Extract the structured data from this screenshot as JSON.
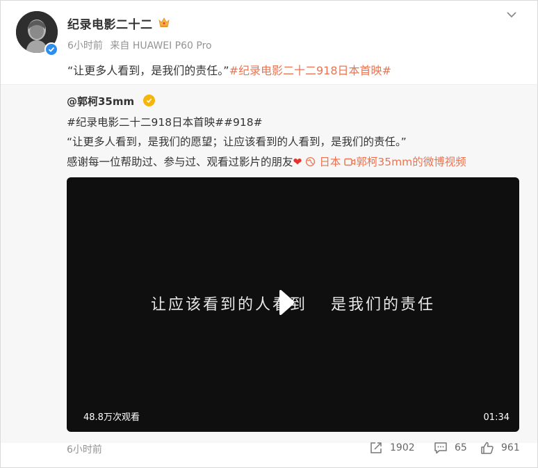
{
  "post": {
    "author": "纪录电影二十二",
    "time": "6小时前",
    "source": "来自 HUAWEI P60 Pro",
    "text": "“让更多人看到，是我们的责任。”",
    "hashtag": "#纪录电影二十二918日本首映#"
  },
  "repost": {
    "author": "@郭柯35mm",
    "hashtags": "#纪录电影二十二918日本首映##918#",
    "line1": "“让更多人看到，是我们的愿望；让应该看到的人看到，是我们的责任。”",
    "line2_text": "感谢每一位帮助过、参与过、观看过影片的朋友",
    "location_label": "日本",
    "video_link_label": "郭柯35mm的微博视频"
  },
  "video": {
    "caption_left": "让应该看到的人看到",
    "caption_right": "是我们的责任",
    "views": "48.8万次观看",
    "duration": "01:34"
  },
  "footer": {
    "time": "6小时前",
    "reposts": "1902",
    "comments": "65",
    "likes": "961"
  },
  "icons": {
    "crown": "crown-icon",
    "verified": "verified-icon",
    "chevron": "chevron-down-icon",
    "location": "location-icon",
    "video": "video-icon",
    "play": "play-icon",
    "repost": "repost-icon",
    "comment": "comment-icon",
    "like": "thumbs-up-icon"
  },
  "colors": {
    "hashtag": "#eb7350",
    "verified_blue": "#2d8ef0",
    "verified_gold": "#f5b50a",
    "heart": "#e6312f"
  }
}
